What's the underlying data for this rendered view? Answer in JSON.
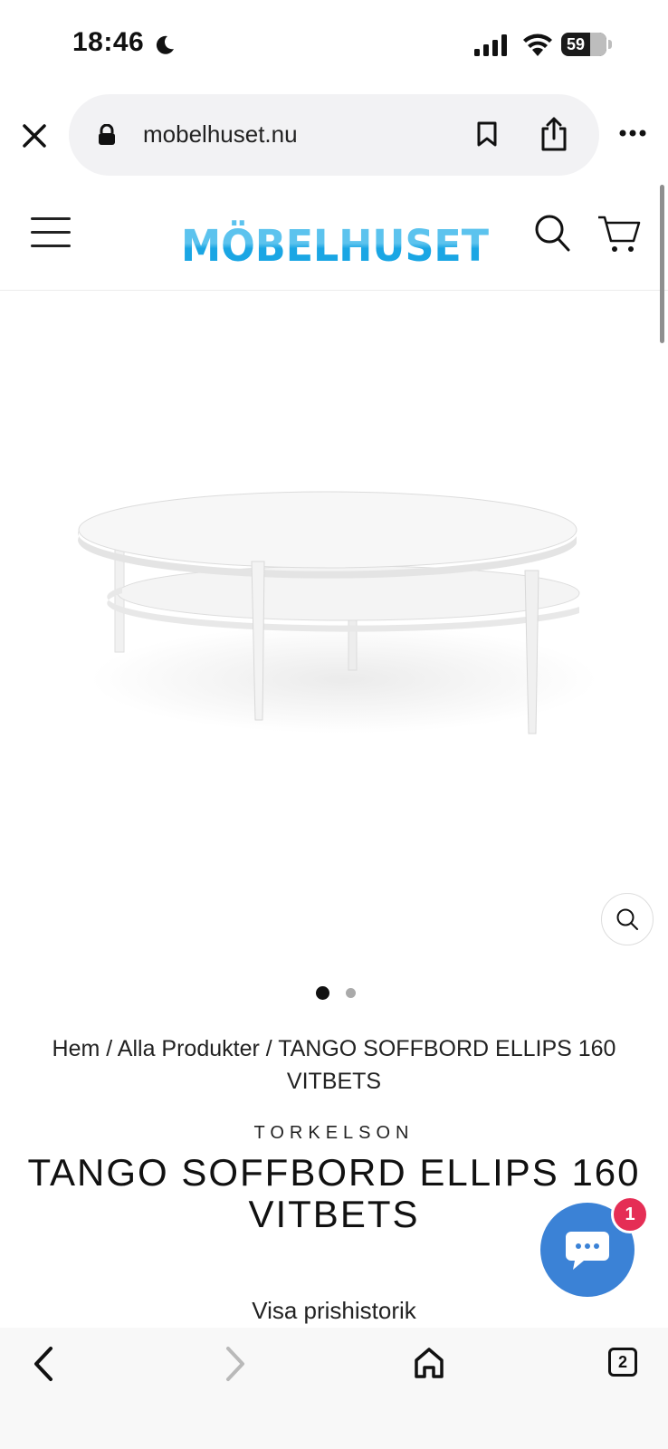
{
  "status_bar": {
    "time": "18:46",
    "battery_level": "59",
    "icons": [
      "moon-icon",
      "signal-icon",
      "wifi-icon",
      "battery-icon"
    ]
  },
  "browser": {
    "url": "mobelhuset.nu",
    "icons": [
      "close-icon",
      "lock-icon",
      "bookmark-icon",
      "share-icon",
      "more-icon"
    ]
  },
  "site_header": {
    "logo_text": "MÖBELHUSET",
    "logo_color": "#29aee6",
    "icons": [
      "menu-icon",
      "search-icon",
      "cart-icon"
    ]
  },
  "product": {
    "image_alt": "White oval coffee table with shelf",
    "carousel_total": 2,
    "carousel_active": 1,
    "breadcrumb": [
      {
        "label": "Hem"
      },
      {
        "label": "Alla Produkter"
      },
      {
        "label": "TANGO SOFFBORD ELLIPS 160 VITBETS"
      }
    ],
    "separator": " / ",
    "brand": "TORKELSON",
    "title": "TANGO SOFFBORD ELLIPS 160 VITBETS",
    "price_history_link": "Visa prishistorik"
  },
  "chat": {
    "badge_count": "1",
    "color": "#3b82d6",
    "badge_color": "#e52e55"
  },
  "bottom_toolbar": {
    "tab_count": "2",
    "icons": [
      "back-icon",
      "forward-icon",
      "home-icon",
      "tabs-icon"
    ]
  }
}
